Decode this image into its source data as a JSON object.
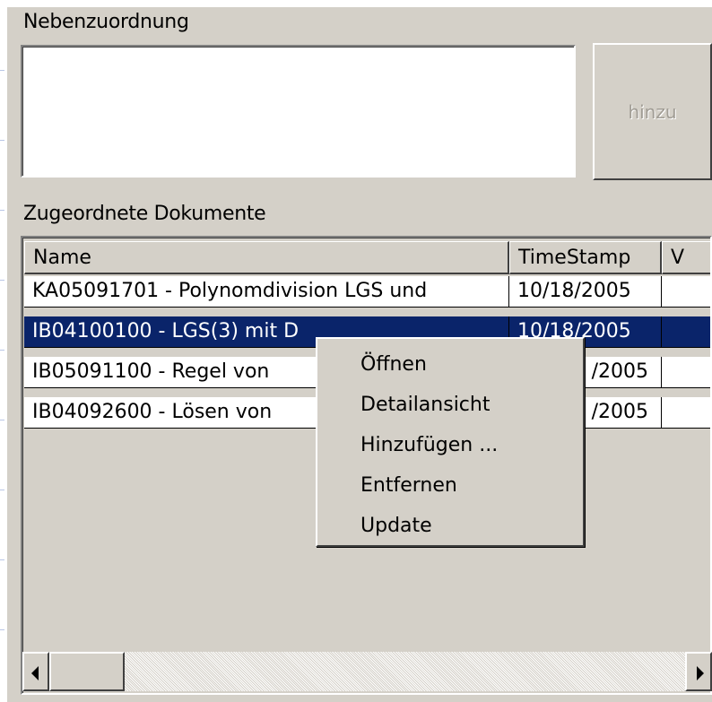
{
  "nebenzuordnung": {
    "label": "Nebenzuordnung",
    "value": "",
    "add_button_label": "hinzu"
  },
  "zugeordnete_dokumente": {
    "label": "Zugeordnete Dokumente",
    "columns": [
      "Name",
      "TimeStamp",
      "V"
    ],
    "rows": [
      {
        "name": "KA05091701 - Polynomdivision LGS und",
        "timestamp": "10/18/2005",
        "v": "",
        "selected": false
      },
      {
        "name": "IB04100100 - LGS(3) mit D",
        "timestamp": "10/18/2005",
        "v": "",
        "selected": true
      },
      {
        "name": "IB05091100 - Regel von",
        "timestamp": "/2005",
        "v": "",
        "selected": false
      },
      {
        "name": "IB04092600 - Lösen von",
        "timestamp": "/2005",
        "v": "",
        "selected": false
      }
    ]
  },
  "context_menu": {
    "items": [
      "Öffnen",
      "Detailansicht",
      "Hinzufügen ...",
      "Entfernen",
      "Update"
    ]
  },
  "scrollbar": {
    "left_icon": "arrow-left-icon",
    "right_icon": "arrow-right-icon"
  },
  "colors": {
    "face": "#d4d0c8",
    "selection": "#0a246a",
    "disabled_text": "#a09c94"
  }
}
